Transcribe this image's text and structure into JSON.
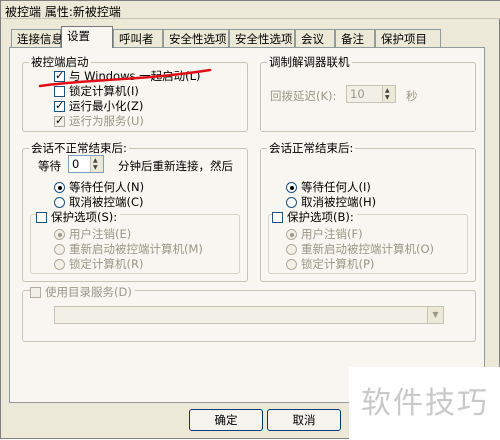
{
  "window": {
    "title": "被控端 属性:新被控端"
  },
  "tabs": [
    "连接信息",
    "设置",
    "呼叫者",
    "安全性选项",
    "安全性选项",
    "会议",
    "备注",
    "保护项目"
  ],
  "startup": {
    "legend": "被控端启动",
    "items": [
      {
        "label": "与 Windows 一起启动(L)",
        "checked": true,
        "disabled": false
      },
      {
        "label": "锁定计算机(I)",
        "checked": false,
        "disabled": false
      },
      {
        "label": "运行最小化(Z)",
        "checked": true,
        "disabled": false
      },
      {
        "label": "运行为服务(U)",
        "checked": true,
        "disabled": true
      }
    ]
  },
  "modem": {
    "legend": "调制解调器联机",
    "delay_label": "回拨延迟(K):",
    "delay_value": "10",
    "unit": "秒"
  },
  "abnormal": {
    "legend": "会话不正常结束后:",
    "wait_label": "等待",
    "wait_value": "0",
    "wait_suffix": "分钟后重新连接，然后",
    "options": [
      "等待任何人(N)",
      "取消被控端(C)"
    ],
    "protect_label": "保护选项(S):",
    "protect_options": [
      "用户注销(E)",
      "重新启动被控端计算机(M)",
      "锁定计算机(R)"
    ]
  },
  "normal": {
    "legend": "会话正常结束后:",
    "options": [
      "等待任何人(I)",
      "取消被控端(H)"
    ],
    "protect_label": "保护选项(B):",
    "protect_options": [
      "用户注销(F)",
      "重新启动被控端计算机(O)",
      "锁定计算机(P)"
    ]
  },
  "directory": {
    "label": "使用目录服务(D)",
    "value": ""
  },
  "buttons": {
    "ok": "确定",
    "cancel": "取消"
  },
  "watermark": "软件技巧",
  "colors": {
    "annotation": "#e0101a",
    "window_bg": "#ece9d8",
    "panel_bg": "#f7f6f0"
  }
}
